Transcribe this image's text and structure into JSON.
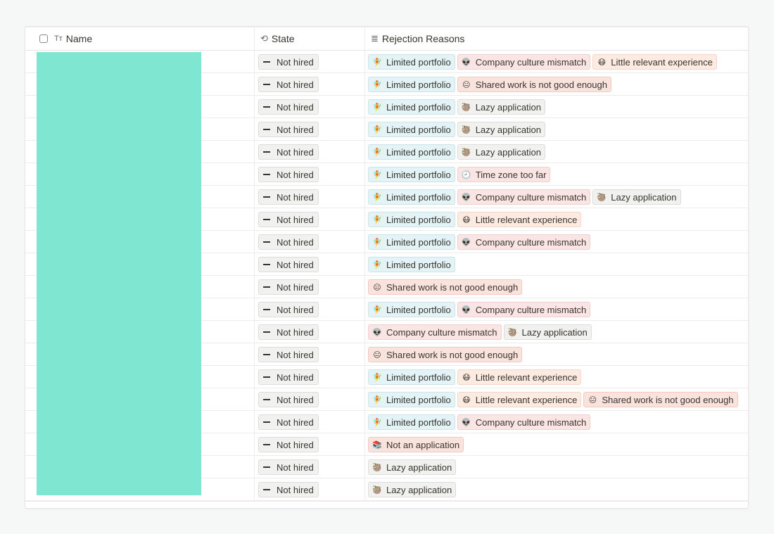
{
  "header": {
    "name_label": "Name",
    "name_icon": "Tт",
    "state_label": "State",
    "state_icon": "⟲",
    "reasons_label": "Rejection Reasons",
    "reasons_icon": "≣"
  },
  "tag_styles": {
    "Limited portfolio": {
      "bg": "#e3f3f6",
      "border": "#c9e5ea",
      "emoji": "🧚"
    },
    "Company culture mismatch": {
      "bg": "#fbe4e4",
      "border": "#f1cfcf",
      "emoji": "👽"
    },
    "Little relevant experience": {
      "bg": "#fdebe1",
      "border": "#f5d7c6",
      "emoji": "😷"
    },
    "Shared work is not good enough": {
      "bg": "#fbe3dd",
      "border": "#f1cbc1",
      "emoji": "😐"
    },
    "Lazy application": {
      "bg": "#f1f1ef",
      "border": "#dcdcd9",
      "emoji": "🦥"
    },
    "Time zone too far": {
      "bg": "#fbe4e4",
      "border": "#f1cfcf",
      "emoji": "🕘"
    },
    "Not an application": {
      "bg": "#fbe3dd",
      "border": "#f1cbc1",
      "emoji": "📚"
    }
  },
  "rows": [
    {
      "state": "Not hired",
      "reasons": [
        "Limited portfolio",
        "Company culture mismatch",
        "Little relevant experience"
      ]
    },
    {
      "state": "Not hired",
      "reasons": [
        "Limited portfolio",
        "Shared work is not good enough"
      ]
    },
    {
      "state": "Not hired",
      "reasons": [
        "Limited portfolio",
        "Lazy application"
      ]
    },
    {
      "state": "Not hired",
      "reasons": [
        "Limited portfolio",
        "Lazy application"
      ]
    },
    {
      "state": "Not hired",
      "reasons": [
        "Limited portfolio",
        "Lazy application"
      ]
    },
    {
      "state": "Not hired",
      "reasons": [
        "Limited portfolio",
        "Time zone too far"
      ]
    },
    {
      "state": "Not hired",
      "reasons": [
        "Limited portfolio",
        "Company culture mismatch",
        "Lazy application"
      ]
    },
    {
      "state": "Not hired",
      "reasons": [
        "Limited portfolio",
        "Little relevant experience"
      ]
    },
    {
      "state": "Not hired",
      "reasons": [
        "Limited portfolio",
        "Company culture mismatch"
      ]
    },
    {
      "state": "Not hired",
      "reasons": [
        "Limited portfolio"
      ]
    },
    {
      "state": "Not hired",
      "reasons": [
        "Shared work is not good enough"
      ]
    },
    {
      "state": "Not hired",
      "reasons": [
        "Limited portfolio",
        "Company culture mismatch"
      ]
    },
    {
      "state": "Not hired",
      "reasons": [
        "Company culture mismatch",
        "Lazy application"
      ]
    },
    {
      "state": "Not hired",
      "reasons": [
        "Shared work is not good enough"
      ]
    },
    {
      "state": "Not hired",
      "reasons": [
        "Limited portfolio",
        "Little relevant experience"
      ]
    },
    {
      "state": "Not hired",
      "reasons": [
        "Limited portfolio",
        "Little relevant experience",
        "Shared work is not good enough"
      ]
    },
    {
      "state": "Not hired",
      "reasons": [
        "Limited portfolio",
        "Company culture mismatch"
      ]
    },
    {
      "state": "Not hired",
      "reasons": [
        "Not an application"
      ]
    },
    {
      "state": "Not hired",
      "reasons": [
        "Lazy application"
      ]
    },
    {
      "state": "Not hired",
      "reasons": [
        "Lazy application"
      ]
    }
  ]
}
